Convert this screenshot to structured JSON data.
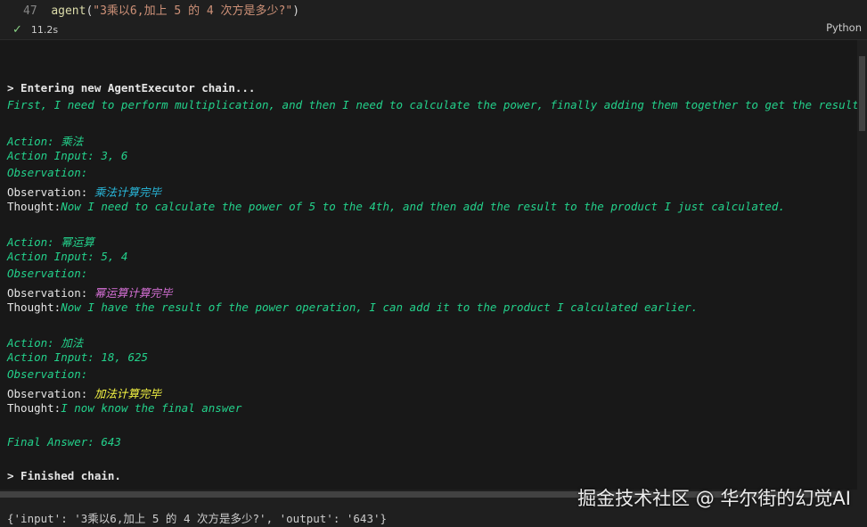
{
  "cell": {
    "line_number": "47",
    "fn_name": "agent",
    "open_paren": "(",
    "string_arg": "\"3乘以6,加上 5 的 4 次方是多少?\"",
    "close_paren": ")",
    "status_time": "11.2s",
    "language": "Python"
  },
  "output": {
    "l01": "> Entering new AgentExecutor chain...",
    "l02": "First, I need to perform multiplication, and then I need to calculate the power, finally adding them together to get the result.",
    "l03": "Action: 乘法",
    "l04": "Action Input: 3, 6",
    "l05": "Observation:",
    "l06_label": "Observation: ",
    "l06_value": "乘法计算完毕",
    "l07_label": "Thought:",
    "l07_value": "Now I need to calculate the power of 5 to the 4th, and then add the result to the product I just calculated.",
    "l08": "Action: 幂运算",
    "l09": "Action Input: 5, 4",
    "l10": "Observation:",
    "l11_label": "Observation: ",
    "l11_value": "幂运算计算完毕",
    "l12_label": "Thought:",
    "l12_value": "Now I have the result of the power operation, I can add it to the product I calculated earlier.",
    "l13": "Action: 加法",
    "l14": "Action Input: 18, 625",
    "l15": "Observation:",
    "l16_label": "Observation: ",
    "l16_value": "加法计算完毕",
    "l17_label": "Thought:",
    "l17_value": "I now know the final answer",
    "l18": "Final Answer: 643",
    "l19": "> Finished chain."
  },
  "result": "{'input': '3乘以6,加上 5 的 4 次方是多少?', 'output': '643'}",
  "watermark": "掘金技术社区 @ 华尔街的幻觉AI",
  "colors": {
    "green": "#23d18b",
    "cyan": "#29b8db",
    "magenta": "#d670d6",
    "yellow": "#f5f543"
  }
}
